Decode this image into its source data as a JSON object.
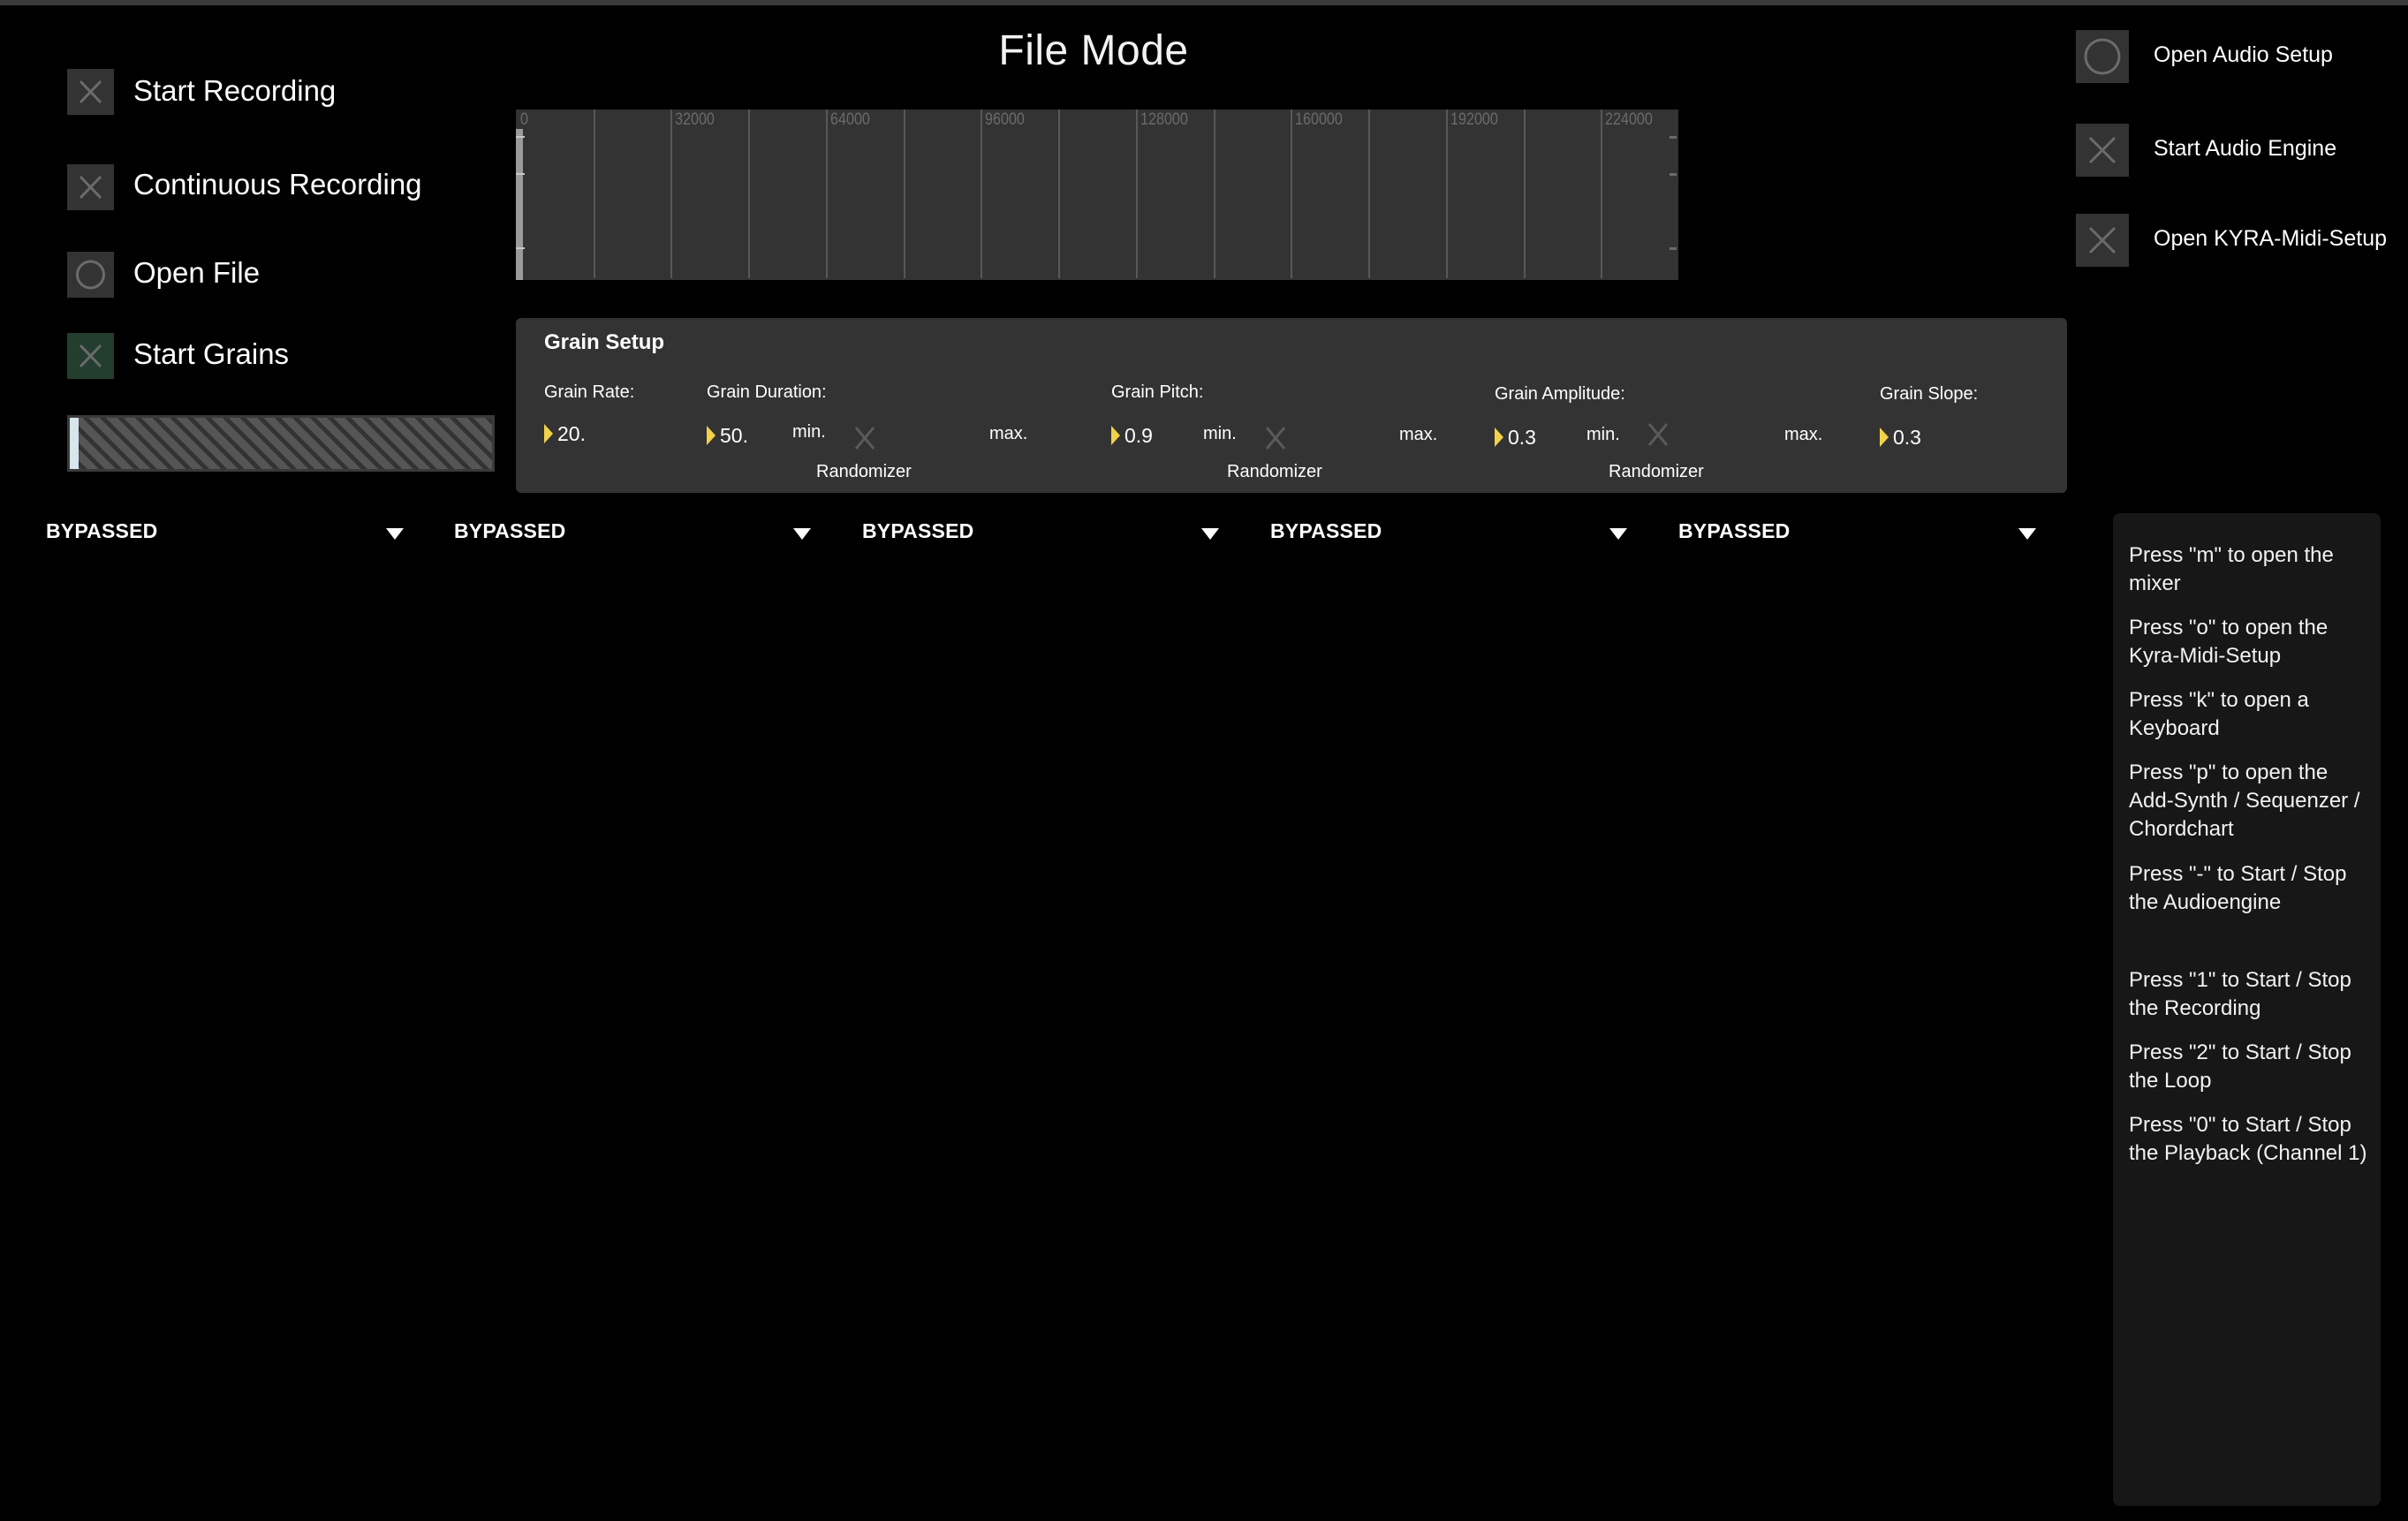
{
  "title": "File Mode",
  "left_controls": [
    {
      "label": "Start Recording",
      "icon": "x-icon",
      "state": "off"
    },
    {
      "label": "Continuous Recording",
      "icon": "x-icon",
      "state": "off"
    },
    {
      "label": "Open File",
      "icon": "circle-icon",
      "state": "off"
    },
    {
      "label": "Start Grains",
      "icon": "x-icon",
      "state": "on"
    }
  ],
  "level_meter": {
    "value_fraction": 0.02
  },
  "waveform": {
    "tick_labels": [
      "0",
      "32000",
      "64000",
      "96000",
      "128000",
      "160000",
      "192000",
      "224000"
    ],
    "grid_step": 16000,
    "max": 240000
  },
  "grain_setup": {
    "title": "Grain Setup",
    "rate": {
      "label": "Grain Rate:",
      "value": "20."
    },
    "duration": {
      "label": "Grain Duration:",
      "value": "50.",
      "min_label": "min.",
      "max_label": "max.",
      "randomizer_label": "Randomizer"
    },
    "pitch": {
      "label": "Grain Pitch:",
      "value": "0.9",
      "min_label": "min.",
      "max_label": "max.",
      "randomizer_label": "Randomizer"
    },
    "amplitude": {
      "label": "Grain Amplitude:",
      "value": "0.3",
      "min_label": "min.",
      "max_label": "max.",
      "randomizer_label": "Randomizer"
    },
    "slope": {
      "label": "Grain Slope:",
      "value": "0.3"
    }
  },
  "effect_slots": [
    "BYPASSED",
    "BYPASSED",
    "BYPASSED",
    "BYPASSED",
    "BYPASSED"
  ],
  "right_controls": [
    {
      "label": "Open Audio Setup",
      "icon": "circle-icon"
    },
    {
      "label": "Start Audio Engine",
      "icon": "x-icon"
    },
    {
      "label": "Open KYRA-Midi-Setup",
      "icon": "x-icon"
    }
  ],
  "help_lines": [
    "Press \"m\" to open the mixer",
    "Press \"o\" to open the Kyra-Midi-Setup",
    "Press \"k\" to open a Keyboard",
    "Press \"p\" to open the Add-Synth / Sequenzer / Chordchart",
    "Press \"-\" to Start / Stop the Audioengine",
    "Press \"1\" to Start / Stop the Recording",
    "Press \"2\" to Start / Stop the Loop",
    "Press \"0\" to Start / Stop the Playback (Channel 1)"
  ],
  "colors": {
    "accent_yellow": "#f2d24a",
    "active_green": "#233d2e",
    "panel": "#333333"
  }
}
